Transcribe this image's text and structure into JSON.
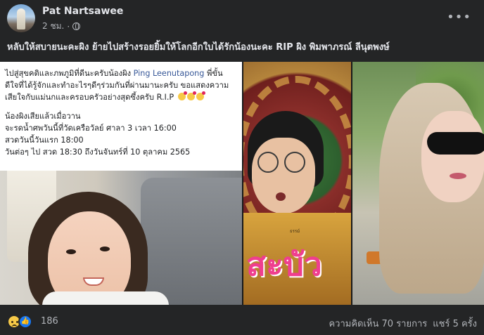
{
  "post": {
    "author": "Pat Nartsawee",
    "time": "2 ชม.",
    "separator": "·",
    "more": "•••",
    "caption": "หลับให้สบายนะคะผิง ย้ายไปสร้างรอยยิ้มให้โลกอีกใบได้รักน้องนะคะ RIP ผิง พิมพาภรณ์ ลีนุตพงษ์"
  },
  "photo1": {
    "line1_before": "ไปสู่สุขคติและภพภูมิที่ดีนะครับน้องผิง ",
    "mention": "Ping Leenutapong",
    "line1_after": " พี่ขั้น",
    "line2": "ดีใจที่ได้รู้จักและทำอะไรๆดีๆร่วมกันที่ผ่านมานะครับ ขอแสดงความ",
    "line3": "เสียใจกับแม่นกและครอบครัวอย่างสุดซึ้งครับ R.I.P",
    "line4": "น้องผิงเสียแล้วเมื่อวาน",
    "line5": "จะรดน้ำศพวันนี้ที่วัดเครือวัลย์ ศาลา 3 เวลา 16:00",
    "line6": "สวดวันนี้วันแรก 18:00",
    "line7": "วันต่อๆ ไป สวด 18:30 ถึงวันจันทร์ที่ 10 ตุลาคม 2565"
  },
  "photo2": {
    "title_art": "สะบัว",
    "credit": "ธรรม์"
  },
  "footer": {
    "reaction_count": "186",
    "comments": "ความคิดเห็น 70 รายการ",
    "shares": "แชร์ 5 ครั้ง"
  }
}
